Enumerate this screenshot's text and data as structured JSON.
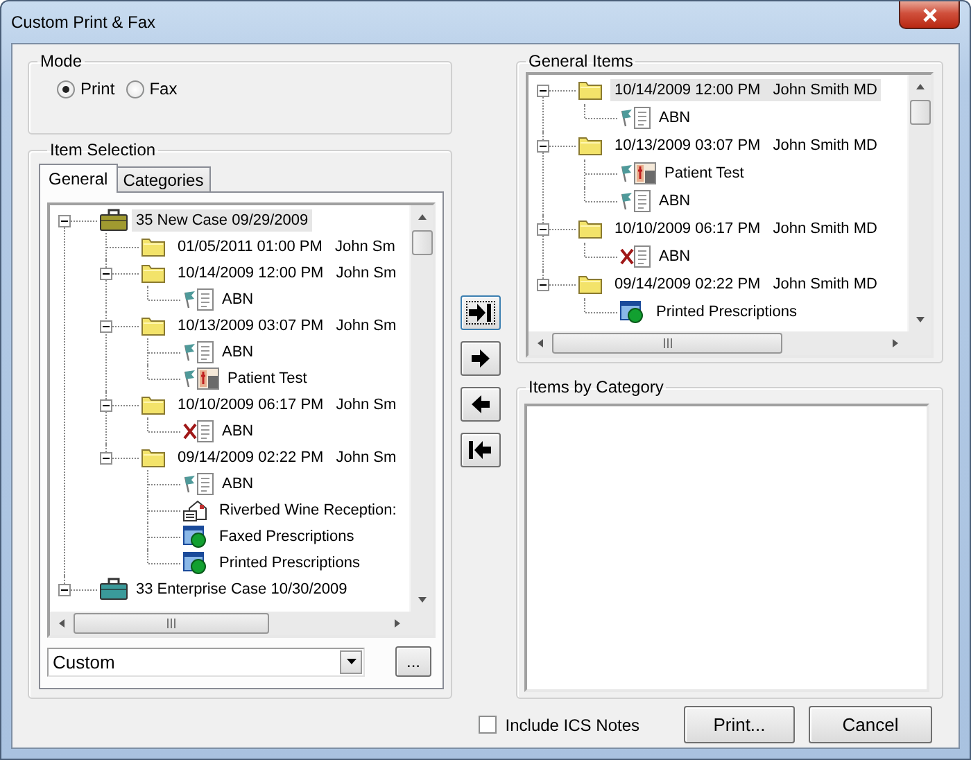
{
  "window": {
    "title": "Custom Print & Fax"
  },
  "mode": {
    "label": "Mode",
    "options": [
      {
        "label": "Print",
        "selected": true
      },
      {
        "label": "Fax",
        "selected": false
      }
    ]
  },
  "item_selection": {
    "label": "Item Selection",
    "tabs": [
      {
        "label": "General",
        "selected": true
      },
      {
        "label": "Categories",
        "selected": false
      }
    ],
    "tree": [
      {
        "kind": "case",
        "color": "#a09a30",
        "label": "35 New Case 09/29/2009",
        "selected": true,
        "expanded": true,
        "children": [
          {
            "kind": "visit",
            "label": "01/05/2011 01:00 PM",
            "provider": "John Sm",
            "selected": false
          },
          {
            "kind": "visit",
            "label": "10/14/2009 12:00 PM",
            "provider": "John Sm",
            "selected": false,
            "expanded": true,
            "children": [
              {
                "kind": "flagged-form",
                "label": "ABN",
                "selected": false
              }
            ]
          },
          {
            "kind": "visit",
            "label": "10/13/2009 03:07 PM",
            "provider": "John Sm",
            "selected": false,
            "expanded": true,
            "children": [
              {
                "kind": "flagged-form",
                "label": "ABN",
                "selected": false
              },
              {
                "kind": "flagged-test",
                "label": "Patient Test",
                "selected": false
              }
            ]
          },
          {
            "kind": "visit",
            "label": "10/10/2009 06:17 PM",
            "provider": "John Sm",
            "selected": false,
            "expanded": true,
            "children": [
              {
                "kind": "crossed-form",
                "label": "ABN",
                "selected": false
              }
            ]
          },
          {
            "kind": "visit",
            "label": "09/14/2009 02:22 PM",
            "provider": "John Sm",
            "selected": false,
            "expanded": true,
            "children": [
              {
                "kind": "flagged-form",
                "label": "ABN",
                "selected": false
              },
              {
                "kind": "letter",
                "label": "Riverbed Wine Reception:",
                "selected": false
              },
              {
                "kind": "prescription",
                "label": "Faxed Prescriptions",
                "selected": false
              },
              {
                "kind": "prescription",
                "label": "Printed Prescriptions",
                "selected": false
              }
            ]
          }
        ]
      },
      {
        "kind": "case",
        "color": "#3a9a9a",
        "label": "33 Enterprise Case 10/30/2009",
        "selected": false,
        "expanded": true
      }
    ],
    "preset": {
      "value": "Custom"
    },
    "browse_button": "..."
  },
  "transfer_buttons": [
    {
      "kind": "add-all",
      "focused": true
    },
    {
      "kind": "add",
      "focused": false
    },
    {
      "kind": "remove",
      "focused": false
    },
    {
      "kind": "remove-all",
      "focused": false
    }
  ],
  "general_items": {
    "label": "General Items",
    "tree": [
      {
        "kind": "visit",
        "label": "10/14/2009 12:00 PM",
        "provider": "John Smith MD",
        "selected": true,
        "expanded": true,
        "children": [
          {
            "kind": "flagged-form",
            "label": "ABN",
            "selected": false
          }
        ]
      },
      {
        "kind": "visit",
        "label": "10/13/2009 03:07 PM",
        "provider": "John Smith MD",
        "selected": false,
        "expanded": true,
        "children": [
          {
            "kind": "flagged-test",
            "label": "Patient Test",
            "selected": false
          },
          {
            "kind": "flagged-form",
            "label": "ABN",
            "selected": false
          }
        ]
      },
      {
        "kind": "visit",
        "label": "10/10/2009 06:17 PM",
        "provider": "John Smith MD",
        "selected": false,
        "expanded": true,
        "children": [
          {
            "kind": "crossed-form",
            "label": "ABN",
            "selected": false
          }
        ]
      },
      {
        "kind": "visit",
        "label": "09/14/2009 02:22 PM",
        "provider": "John Smith MD",
        "selected": false,
        "expanded": true,
        "children": [
          {
            "kind": "prescription",
            "label": "Printed Prescriptions",
            "selected": false
          }
        ]
      }
    ]
  },
  "items_by_category": {
    "label": "Items by Category"
  },
  "include_ics_notes": {
    "label": "Include ICS Notes",
    "checked": false
  },
  "buttons": [
    {
      "label": "Print..."
    },
    {
      "label": "Cancel"
    }
  ]
}
